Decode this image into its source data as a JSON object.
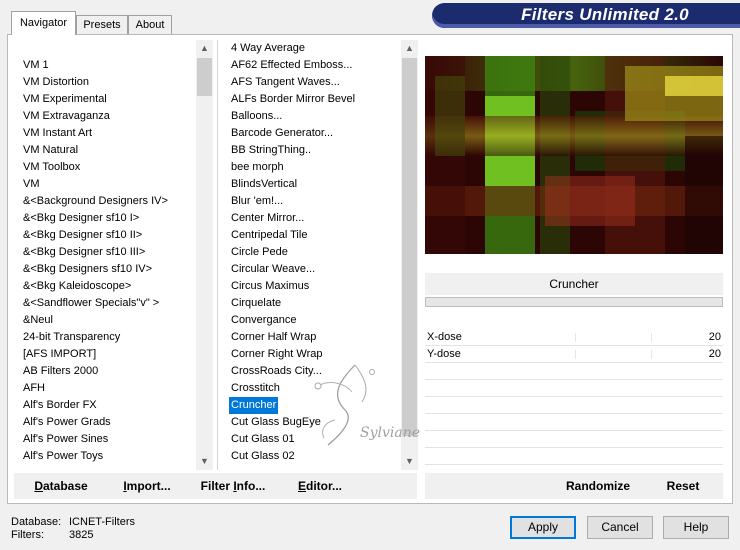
{
  "app": {
    "title": "Filters Unlimited 2.0"
  },
  "tabs": [
    {
      "label": "Navigator",
      "active": true
    },
    {
      "label": "Presets",
      "active": false
    },
    {
      "label": "About",
      "active": false
    }
  ],
  "categories": [
    "VM 1",
    "VM Distortion",
    "VM Experimental",
    "VM Extravaganza",
    "VM Instant Art",
    "VM Natural",
    "VM Toolbox",
    "VM",
    "&<Background Designers IV>",
    "&<Bkg Designer sf10 I>",
    "&<Bkg Designer sf10 II>",
    "&<Bkg Designer sf10 III>",
    "&<Bkg Designers sf10 IV>",
    "&<Bkg Kaleidoscope>",
    "&<Sandflower Specials\"v\" >",
    "&Neul",
    "24-bit Transparency",
    "[AFS IMPORT]",
    "AB Filters 2000",
    "AFH",
    "Alf's Border FX",
    "Alf's Power Grads",
    "Alf's Power Sines",
    "Alf's Power Toys"
  ],
  "filters": [
    "4 Way Average",
    "AF62 Effected Emboss...",
    "AFS Tangent Waves...",
    "ALFs Border Mirror Bevel",
    "Balloons...",
    "Barcode Generator...",
    "BB StringThing..",
    "bee morph",
    "BlindsVertical",
    "Blur 'em!...",
    "Center Mirror...",
    "Centripedal Tile",
    "Circle Pede",
    "Circular Weave...",
    "Circus Maximus",
    "Cirquelate",
    "Convergance",
    "Corner Half Wrap",
    "Corner Right Wrap",
    "CrossRoads City...",
    "Crosstitch",
    "Cruncher",
    "Cut Glass  BugEye",
    "Cut Glass 01",
    "Cut Glass 02"
  ],
  "selected_filter_index": 21,
  "current_filter": "Cruncher",
  "params": [
    {
      "label": "X-dose",
      "value": "20"
    },
    {
      "label": "Y-dose",
      "value": "20"
    }
  ],
  "toolbar": {
    "database_label": "atabase",
    "database_accel": "D",
    "import_label": "mport...",
    "import_prefix": "I",
    "filterinfo_label": "Filter ",
    "filterinfo_accel": "I",
    "filterinfo_rest": "nfo...",
    "editor_label": "ditor...",
    "editor_accel": "E",
    "randomize_label": "Randomize",
    "reset_label": "Reset"
  },
  "status": {
    "database_label": "Database:",
    "database_value": "ICNET-Filters",
    "filters_label": "Filters:",
    "filters_value": "3825"
  },
  "buttons": {
    "apply": "Apply",
    "cancel": "Cancel",
    "help": "Help"
  },
  "watermark": {
    "text": "Sylviane"
  },
  "colors": {
    "selection": "#0078d7",
    "banner": "#1c2a6e",
    "primary_button_border": "#0078d7"
  }
}
